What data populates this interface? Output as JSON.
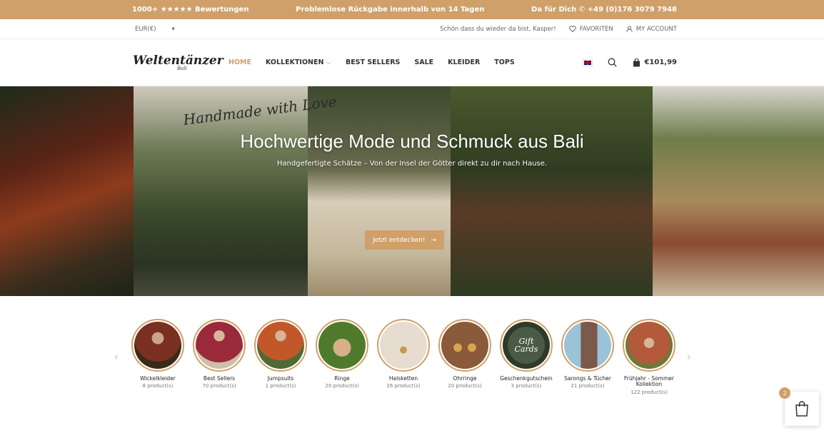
{
  "topbar": {
    "reviews": "1000+ ★★★★★ Bewertungen",
    "returns": "Problemlose Rückgabe innerhalb von 14 Tagen",
    "contact": "Da für Dich ✆ +49 (0)176 3079 7948"
  },
  "utility": {
    "currency": "EUR(€)",
    "currency_arrow": "▾",
    "greeting": "Schön dass du wieder da bist, Kasper!",
    "favorites": "Favoriten",
    "account": "My Account"
  },
  "header": {
    "logo_main": "Weltentänzer",
    "logo_sub": "Bali",
    "nav": [
      "HOME",
      "KOLLEKTIONEN",
      "BEST SELLERS",
      "SALE",
      "KLEIDER",
      "TOPS"
    ],
    "nav_chevron": "⌵",
    "cart_total": "€101,99"
  },
  "hero": {
    "script": "Handmade with Love",
    "title": "Hochwertige Mode und Schmuck aus Bali",
    "subtitle": "Handgefertigte Schätze – Von der Insel der Götter direkt zu dir nach Hause.",
    "button": "Jetzt entdecken!",
    "button_arrow": "→"
  },
  "categories": [
    {
      "name": "Wickelkleider",
      "count": "8 product(s)",
      "color": "#7a3020"
    },
    {
      "name": "Best Sellers",
      "count": "70 product(s)",
      "color": "#9a2a3a"
    },
    {
      "name": "Jumpsuits",
      "count": "1 product(s)",
      "color": "#c2582a"
    },
    {
      "name": "Ringe",
      "count": "20 product(s)",
      "color": "#4f7a2c"
    },
    {
      "name": "Halsketten",
      "count": "26 product(s)",
      "color": "#e6ddd0"
    },
    {
      "name": "Ohrringe",
      "count": "20 product(s)",
      "color": "#8a5a3a"
    },
    {
      "name": "Geschenkgutschein",
      "count": "3 product(s)",
      "color": "#3f4a3a"
    },
    {
      "name": "Sarongs & Tücher",
      "count": "21 product(s)",
      "color": "#7a5a4a"
    },
    {
      "name": "Frühjahr - Sommer Kollektion",
      "count": "122 product(s)",
      "color": "#b25a3a"
    }
  ],
  "slider": {
    "prev": "‹",
    "next": "›"
  },
  "floating_cart": {
    "badge": "2"
  },
  "colors": {
    "accent": "#d0a06a"
  }
}
